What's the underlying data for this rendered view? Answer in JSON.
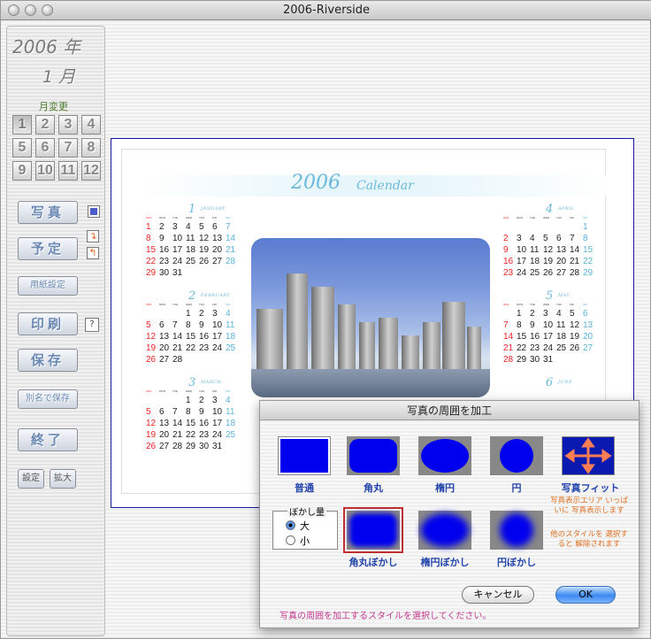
{
  "window": {
    "title": "2006-Riverside"
  },
  "sidebar": {
    "year": "2006 年",
    "month": "1 月",
    "month_change_label": "月変更",
    "month_buttons": [
      "1",
      "2",
      "3",
      "4",
      "5",
      "6",
      "7",
      "8",
      "9",
      "10",
      "11",
      "12"
    ],
    "selected_month": "1",
    "photo_label": "写真",
    "schedule_label": "予定",
    "paper_settings_label": "用紙設定",
    "print_label": "印刷",
    "save_label": "保存",
    "save_as_label": "別名で保存",
    "quit_label": "終了",
    "settings_label": "設定",
    "zoom_label": "拡大",
    "help_label": "?"
  },
  "calendar": {
    "year_title": "2006",
    "title_word": "Calendar",
    "dow": [
      "SUN",
      "MON",
      "TUE",
      "WED",
      "THU",
      "FRI",
      "SAT"
    ],
    "months": [
      {
        "num": "1",
        "name": "JANUARY",
        "rows": [
          [
            "1",
            "2",
            "3",
            "4",
            "5",
            "6",
            "7"
          ],
          [
            "8",
            "9",
            "10",
            "11",
            "12",
            "13",
            "14"
          ],
          [
            "15",
            "16",
            "17",
            "18",
            "19",
            "20",
            "21"
          ],
          [
            "22",
            "23",
            "24",
            "25",
            "26",
            "27",
            "28"
          ],
          [
            "29",
            "30",
            "31",
            "",
            "",
            "",
            ""
          ]
        ]
      },
      {
        "num": "2",
        "name": "FEBRUARY",
        "rows": [
          [
            "",
            "",
            "",
            "1",
            "2",
            "3",
            "4"
          ],
          [
            "5",
            "6",
            "7",
            "8",
            "9",
            "10",
            "11"
          ],
          [
            "12",
            "13",
            "14",
            "15",
            "16",
            "17",
            "18"
          ],
          [
            "19",
            "20",
            "21",
            "22",
            "23",
            "24",
            "25"
          ],
          [
            "26",
            "27",
            "28",
            "",
            "",
            "",
            ""
          ]
        ]
      },
      {
        "num": "3",
        "name": "MARCH",
        "rows": [
          [
            "",
            "",
            "",
            "1",
            "2",
            "3",
            "4"
          ],
          [
            "5",
            "6",
            "7",
            "8",
            "9",
            "10",
            "11"
          ],
          [
            "12",
            "13",
            "14",
            "15",
            "16",
            "17",
            "18"
          ],
          [
            "19",
            "20",
            "21",
            "22",
            "23",
            "24",
            "25"
          ],
          [
            "26",
            "27",
            "28",
            "29",
            "30",
            "31",
            ""
          ]
        ]
      },
      {
        "num": "4",
        "name": "APRIL",
        "rows": [
          [
            "",
            "",
            "",
            "",
            "",
            "",
            "1"
          ],
          [
            "2",
            "3",
            "4",
            "5",
            "6",
            "7",
            "8"
          ],
          [
            "9",
            "10",
            "11",
            "12",
            "13",
            "14",
            "15"
          ],
          [
            "16",
            "17",
            "18",
            "19",
            "20",
            "21",
            "22"
          ],
          [
            "23",
            "24",
            "25",
            "26",
            "27",
            "28",
            "29"
          ]
        ]
      },
      {
        "num": "5",
        "name": "MAY",
        "rows": [
          [
            "",
            "1",
            "2",
            "3",
            "4",
            "5",
            "6"
          ],
          [
            "7",
            "8",
            "9",
            "10",
            "11",
            "12",
            "13"
          ],
          [
            "14",
            "15",
            "16",
            "17",
            "18",
            "19",
            "20"
          ],
          [
            "21",
            "22",
            "23",
            "24",
            "25",
            "26",
            "27"
          ],
          [
            "28",
            "29",
            "30",
            "31",
            "",
            "",
            ""
          ]
        ]
      },
      {
        "num": "6",
        "name": "JUNE",
        "rows": []
      }
    ]
  },
  "dialog": {
    "title": "写真の周囲を加工",
    "options": [
      {
        "label": "普通"
      },
      {
        "label": "角丸"
      },
      {
        "label": "楕円"
      },
      {
        "label": "円"
      },
      {
        "label": "写真フィット"
      },
      {
        "label": "角丸ぼかし"
      },
      {
        "label": "楕円ぼかし"
      },
      {
        "label": "円ぼかし"
      }
    ],
    "fit_note": "写真表示エリア いっぱいに 写真表示します",
    "other_note": "他のスタイルを 選択すると 解除されます",
    "blur_group_title": "ぼかし量",
    "blur_large": "大",
    "blur_small": "小",
    "cancel_label": "キャンセル",
    "ok_label": "OK",
    "footer": "写真の周囲を加工するスタイルを選択してください。",
    "colors": {
      "accent": "#0000ee",
      "note": "#e07020",
      "footer": "#c2378f"
    }
  }
}
